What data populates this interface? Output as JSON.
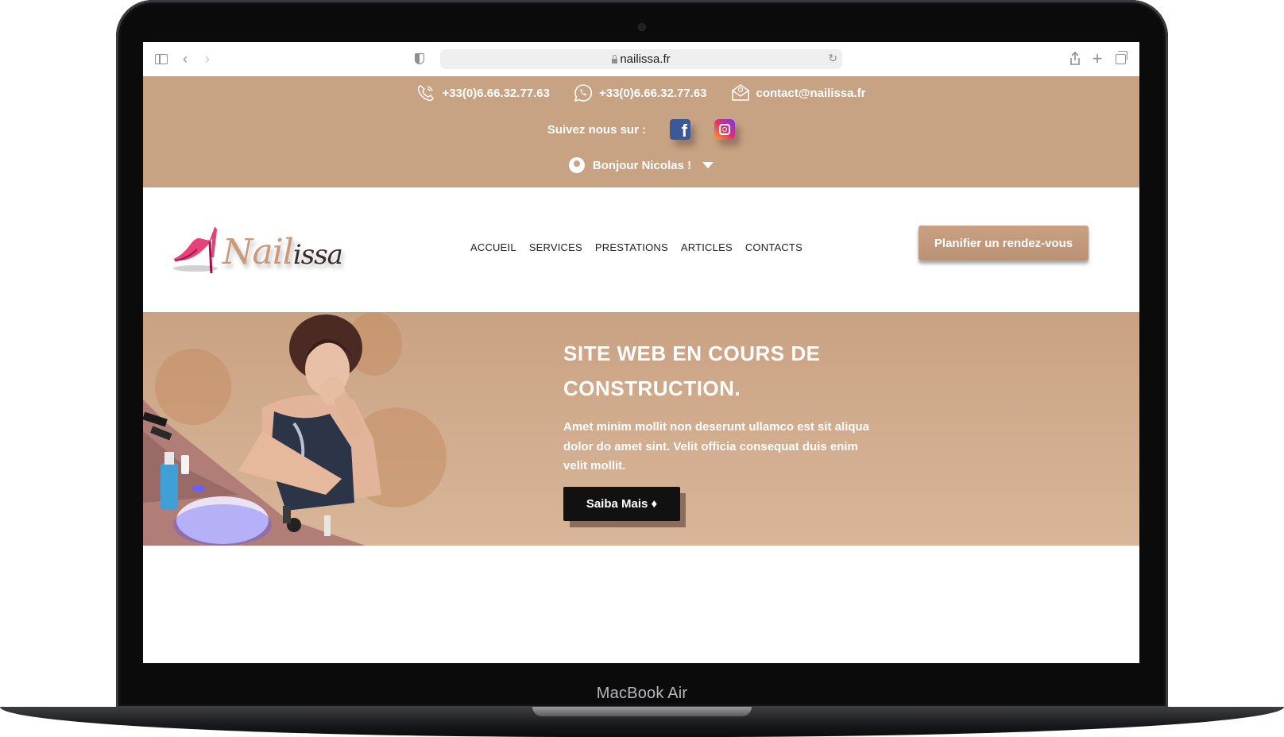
{
  "device": {
    "brand_label": "MacBook Air"
  },
  "browser": {
    "url": "nailissa.fr",
    "icons": {
      "sidebar": "sidebar-icon",
      "back": "chevron-left-icon",
      "forward": "chevron-right-icon",
      "privacy": "shield-icon",
      "lock": "lock-icon",
      "reload": "reload-icon",
      "share": "share-icon",
      "new_tab": "plus-icon",
      "tabs": "tabs-overview-icon"
    }
  },
  "topbar": {
    "phone": "+33(0)6.66.32.77.63",
    "whatsapp": "+33(0)6.66.32.77.63",
    "email": "contact@nailissa.fr",
    "follow_label": "Suivez nous sur :",
    "greeting": "Bonjour Nicolas !"
  },
  "header": {
    "logo_text_light": "Nail",
    "logo_text_dark": "issa",
    "nav": [
      "ACCUEIL",
      "SERVICES",
      "PRESTATIONS",
      "ARTICLES",
      "CONTACTS"
    ],
    "cta_label": "Planifier un rendez-vous"
  },
  "hero": {
    "title": "SITE WEB EN COURS DE CONSTRUCTION.",
    "text": "Amet minim mollit non deserunt ullamco est sit aliqua dolor do amet sint. Velit officia consequat duis enim velit mollit.",
    "button_label": "Saiba Mais ♦"
  },
  "colors": {
    "accent": "#c7a283",
    "cta": "#bb9273",
    "hero_button": "#111111",
    "facebook": "#3b5998"
  }
}
